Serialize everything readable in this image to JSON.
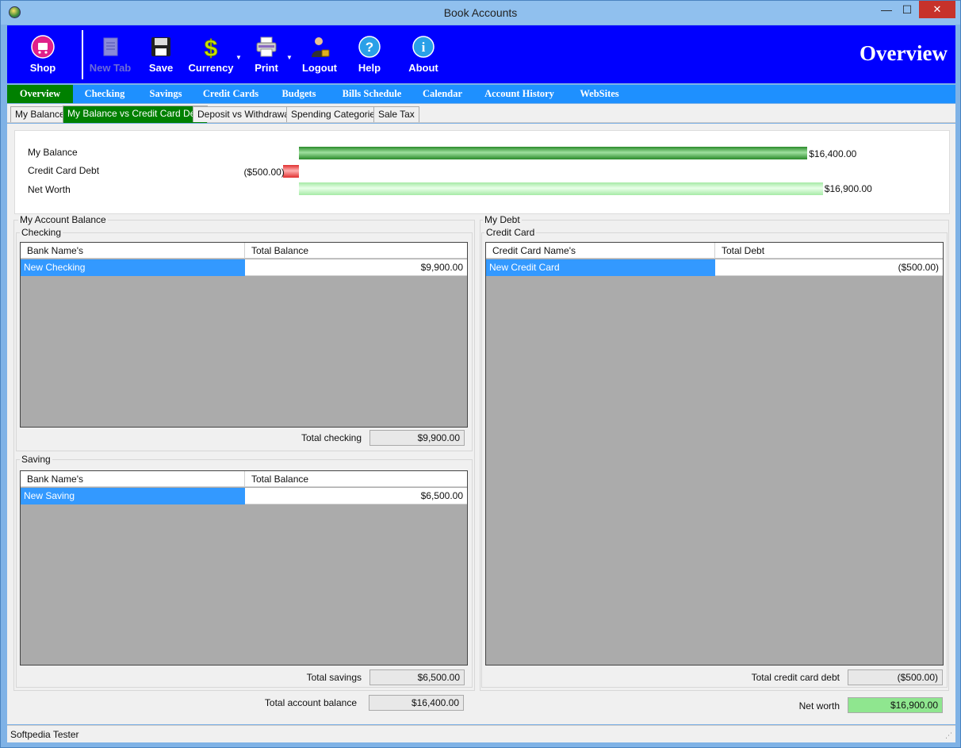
{
  "window": {
    "title": "Book Accounts",
    "minimize": "—",
    "maximize": "☐",
    "close": "✕"
  },
  "toolbar": {
    "shop": "Shop",
    "new_tab": "New Tab",
    "save": "Save",
    "currency": "Currency",
    "print": "Print",
    "logout": "Logout",
    "help": "Help",
    "about": "About",
    "page_title": "Overview"
  },
  "mainnav": {
    "items": [
      "Overview",
      "Checking",
      "Savings",
      "Credit Cards",
      "Budgets",
      "Bills Schedule",
      "Calendar",
      "Account History",
      "WebSites"
    ]
  },
  "subtabs": {
    "items": [
      "My Balance",
      "My Balance vs Credit Card Debt",
      "Deposit vs Withdrawal",
      "Spending Categories",
      "Sale Tax"
    ]
  },
  "chart": {
    "rows": [
      {
        "label": "My Balance",
        "value": "$16,400.00",
        "amount": 16400
      },
      {
        "label": "Credit Card Debt",
        "value": "($500.00)",
        "amount": -500
      },
      {
        "label": "Net Worth",
        "value": "$16,900.00",
        "amount": 16900
      }
    ]
  },
  "account_balance": {
    "title": "My Account Balance",
    "checking": {
      "title": "Checking",
      "col1": "Bank Name's",
      "col2": "Total Balance",
      "row_name": "New Checking",
      "row_value": "$9,900.00",
      "total_label": "Total checking",
      "total_value": "$9,900.00"
    },
    "saving": {
      "title": "Saving",
      "col1": "Bank Name's",
      "col2": "Total Balance",
      "row_name": "New Saving",
      "row_value": "$6,500.00",
      "total_label": "Total savings",
      "total_value": "$6,500.00"
    },
    "total_label": "Total account balance",
    "total_value": "$16,400.00"
  },
  "debt": {
    "title": "My Debt",
    "credit_card": {
      "title": "Credit Card",
      "col1": "Credit Card Name's",
      "col2": "Total Debt",
      "row_name": "New Credit Card",
      "row_value": "($500.00)",
      "total_label": "Total credit card debt",
      "total_value": "($500.00)"
    },
    "networth_label": "Net worth",
    "networth_value": "$16,900.00"
  },
  "status": {
    "text": "Softpedia Tester"
  },
  "colors": {
    "toolbar": "#0000ff",
    "nav": "#1e90ff",
    "active": "#008000",
    "selected_row": "#3399ff"
  }
}
